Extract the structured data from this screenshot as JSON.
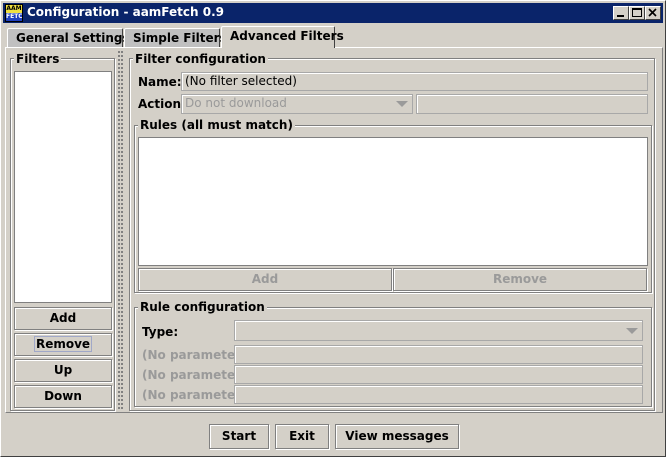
{
  "window": {
    "title": "Configuration - aamFetch 0.9",
    "icon_line1": "AAM",
    "icon_line2": "FETCH",
    "controls": [
      "minimize-icon",
      "maximize-icon",
      "close-icon"
    ]
  },
  "tabs": [
    {
      "label": "General Settings",
      "active": false
    },
    {
      "label": "Simple Filters",
      "active": false
    },
    {
      "label": "Advanced Filters",
      "active": true
    }
  ],
  "filters_panel": {
    "title": "Filters",
    "buttons": {
      "add": "Add",
      "remove": "Remove",
      "up": "Up",
      "down": "Down"
    }
  },
  "filter_config": {
    "title": "Filter configuration",
    "name_label": "Name:",
    "name_value": "(No filter selected)",
    "action_label": "Action:",
    "action_value": "Do not download",
    "action_extra_value": ""
  },
  "rules": {
    "title": "Rules (all must match)",
    "add_label": "Add",
    "remove_label": "Remove"
  },
  "rule_config": {
    "title": "Rule configuration",
    "type_label": "Type:",
    "type_value": "",
    "params": [
      {
        "label": "(No parameter)",
        "value": ""
      },
      {
        "label": "(No parameter)",
        "value": ""
      },
      {
        "label": "(No parameter)",
        "value": ""
      }
    ]
  },
  "footer": {
    "start": "Start",
    "exit": "Exit",
    "view_messages": "View messages"
  },
  "colors": {
    "titlebar": "#0a246a",
    "face": "#d4d0c8",
    "disabled_text": "#9a9a9a"
  }
}
